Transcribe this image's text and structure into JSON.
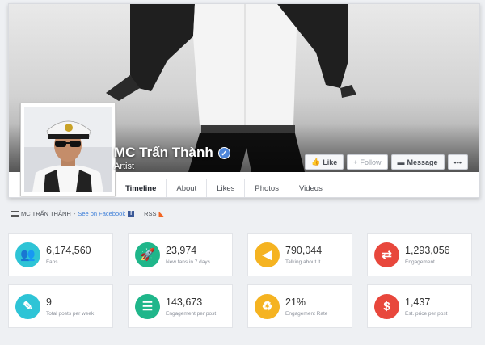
{
  "profile": {
    "name": "MC Trấn Thành",
    "category": "Artist",
    "verified_icon": "verified-check-icon"
  },
  "actions": {
    "like_label": "Like",
    "follow_label": "Follow",
    "message_label": "Message",
    "more_label": "•••"
  },
  "tabs": [
    {
      "label": "Timeline",
      "active": true
    },
    {
      "label": "About",
      "active": false
    },
    {
      "label": "Likes",
      "active": false
    },
    {
      "label": "Photos",
      "active": false
    },
    {
      "label": "Videos",
      "active": false
    }
  ],
  "source": {
    "page_label": "MC TRẤN THÀNH",
    "separator": "-",
    "facebook_link": "See on Facebook",
    "rss_label": "RSS"
  },
  "stats": [
    {
      "value": "6,174,560",
      "label": "Fans",
      "icon": "users-icon",
      "color": "#2ec4d6"
    },
    {
      "value": "23,974",
      "label": "New fans in 7 days",
      "icon": "rocket-icon",
      "color": "#1fb68a"
    },
    {
      "value": "790,044",
      "label": "Talking about it",
      "icon": "megaphone-icon",
      "color": "#f5b321"
    },
    {
      "value": "1,293,056",
      "label": "Engagement",
      "icon": "exchange-icon",
      "color": "#e8473c"
    },
    {
      "value": "9",
      "label": "Total posts per week",
      "icon": "edit-icon",
      "color": "#2ec4d6"
    },
    {
      "value": "143,673",
      "label": "Engagement per post",
      "icon": "sliders-icon",
      "color": "#1fb68a"
    },
    {
      "value": "21%",
      "label": "Engagement Rate",
      "icon": "recycle-icon",
      "color": "#f5b321"
    },
    {
      "value": "1,437",
      "label": "Est. price per post",
      "icon": "dollar-icon",
      "color": "#e8473c"
    }
  ],
  "colors": {
    "brand_blue": "#3b5998",
    "link_blue": "#3b7dd8",
    "background": "#eef0f3"
  }
}
